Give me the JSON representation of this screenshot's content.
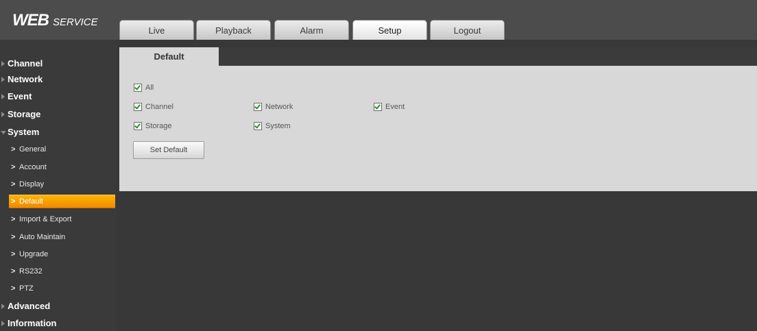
{
  "logo": {
    "main": "WEB",
    "sub": "SERVICE"
  },
  "nav": {
    "tabs": [
      "Live",
      "Playback",
      "Alarm",
      "Setup",
      "Logout"
    ],
    "active": "Setup"
  },
  "sidebar": {
    "sections": [
      {
        "label": "Channel",
        "expanded": false
      },
      {
        "label": "Network",
        "expanded": false
      },
      {
        "label": "Event",
        "expanded": false
      },
      {
        "label": "Storage",
        "expanded": false
      },
      {
        "label": "System",
        "expanded": true
      },
      {
        "label": "Advanced",
        "expanded": false
      },
      {
        "label": "Information",
        "expanded": false
      }
    ],
    "system_items": [
      "General",
      "Account",
      "Display",
      "Default",
      "Import & Export",
      "Auto Maintain",
      "Upgrade",
      "RS232",
      "PTZ"
    ],
    "active_item": "Default"
  },
  "content": {
    "tab_label": "Default",
    "checkboxes": {
      "all": "All",
      "channel": "Channel",
      "network": "Network",
      "event": "Event",
      "storage": "Storage",
      "system": "System"
    },
    "button_label": "Set Default"
  },
  "colors": {
    "accent": "#f29a00",
    "background": "#383838",
    "panel": "#d8d8d8"
  }
}
